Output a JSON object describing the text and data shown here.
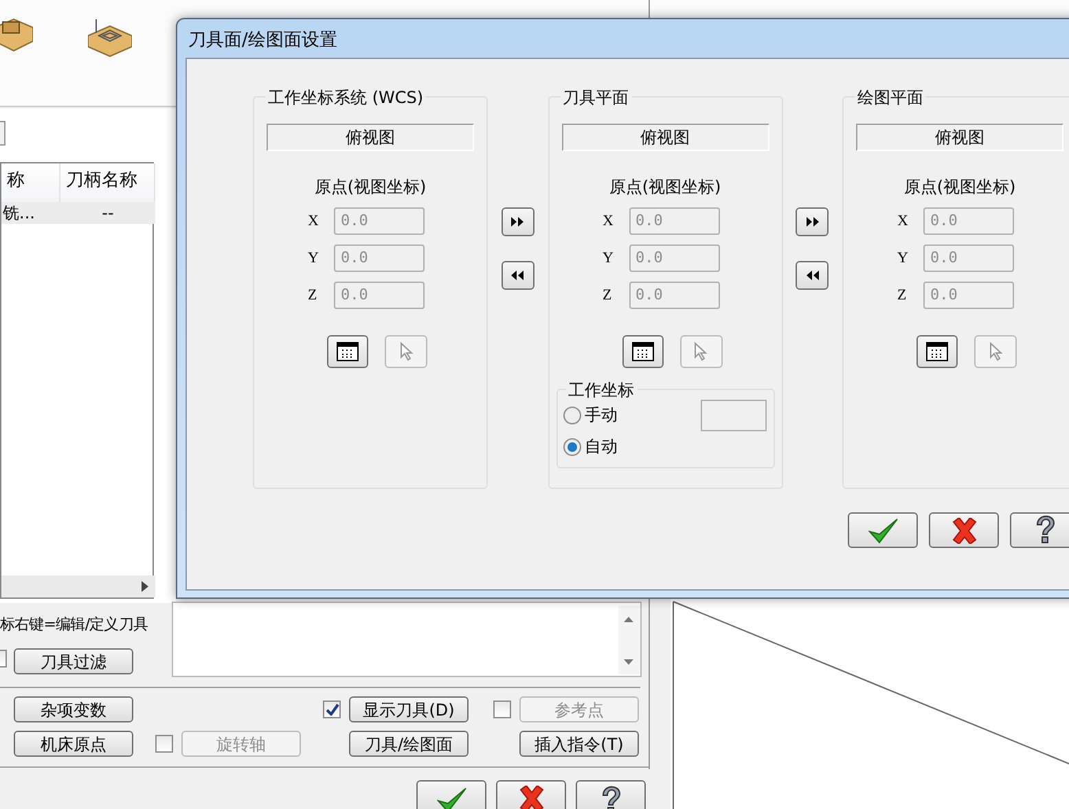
{
  "background_window": {
    "tool_table": {
      "columns": [
        "称",
        "刀柄名称"
      ],
      "rows": [
        [
          "铣...",
          "--"
        ]
      ]
    },
    "hint": "标右键=编辑/定义刀具",
    "filter": {
      "checked": false,
      "label": "刀具过滤"
    },
    "options": [
      {
        "label": "杂项变数",
        "kind": "button",
        "disabled": false
      },
      {
        "label": "显示刀具(D)",
        "kind": "checkbox",
        "checked": true,
        "disabled": false
      },
      {
        "label": "参考点",
        "kind": "checkbox",
        "checked": false,
        "disabled": true
      },
      {
        "label": "机床原点",
        "kind": "button",
        "disabled": false
      },
      {
        "label": "旋转轴",
        "kind": "checkbox",
        "checked": false,
        "disabled": true
      },
      {
        "label": "刀具/绘图面",
        "kind": "button",
        "disabled": false
      },
      {
        "label": "插入指令(T)",
        "kind": "button",
        "disabled": false
      }
    ]
  },
  "dialog": {
    "title": "刀具面/绘图面设置",
    "planes": [
      {
        "title": "工作坐标系统 (WCS)",
        "view": "俯视图",
        "origin_label": "原点(视图坐标)",
        "coords": [
          {
            "axis": "X",
            "value": "0.0"
          },
          {
            "axis": "Y",
            "value": "0.0"
          },
          {
            "axis": "Z",
            "value": "0.0"
          }
        ]
      },
      {
        "title": "刀具平面",
        "view": "俯视图",
        "origin_label": "原点(视图坐标)",
        "coords": [
          {
            "axis": "X",
            "value": "0.0"
          },
          {
            "axis": "Y",
            "value": "0.0"
          },
          {
            "axis": "Z",
            "value": "0.0"
          }
        ],
        "work_coords": {
          "title": "工作坐标",
          "options": [
            {
              "label": "手动",
              "selected": false
            },
            {
              "label": "自动",
              "selected": true
            }
          ]
        }
      },
      {
        "title": "绘图平面",
        "view": "俯视图",
        "origin_label": "原点(视图坐标)",
        "coords": [
          {
            "axis": "X",
            "value": "0.0"
          },
          {
            "axis": "Y",
            "value": "0.0"
          },
          {
            "axis": "Z",
            "value": "0.0"
          }
        ]
      }
    ]
  }
}
